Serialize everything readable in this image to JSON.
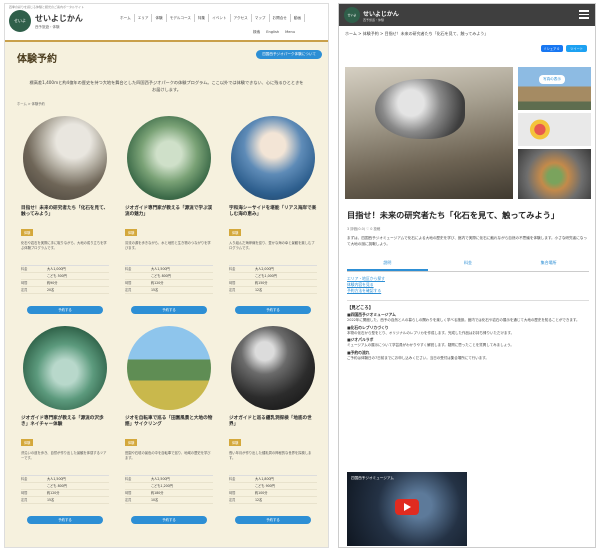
{
  "left": {
    "header_tiny": "四季の彩りを感じる体験と観光のご案内ポータルサイト",
    "logo_text": "せいよ",
    "brand": "せいよじかん",
    "brand_sub": "西予旅遊・体験",
    "nav": [
      "ホーム",
      "エリア",
      "体験",
      "モデルコース",
      "特集",
      "イベント",
      "アクセス",
      "マップ",
      "お問合せ",
      "動画"
    ],
    "nav2": [
      "検索",
      "English",
      "Menu"
    ],
    "page_title": "体験予約",
    "pill": "四国西予ジオパーク体験について",
    "intro": "標高差1,400mと約4億年の歴史を持つ大地を舞台とした四国西予ジオパークの体験プログラム。ここ以外では体験できない、心に残るひとときをお届けします。",
    "breadcrumb": "ホーム > 体験予約",
    "cards": [
      {
        "title": "目指せ！未来の研究者たち「化石を見て、触ってみよう」",
        "tag": "体験",
        "desc": "化石や岩石を実際に手に取りながら、大地の成り立ちを学ぶ体験プログラムです。",
        "rows": [
          [
            "料金",
            "大人1,000円"
          ],
          [
            "",
            "こども 500円"
          ],
          [
            "時間",
            "約90分"
          ],
          [
            "定員",
            "20名"
          ]
        ],
        "button": "予約する"
      },
      {
        "title": "ジオガイド専門家が教える「源流で学ぶ渓流の魅力」",
        "tag": "体験",
        "desc": "清流の源を歩きながら、水と地形と生き物のつながりを学びます。",
        "rows": [
          [
            "料金",
            "大人1,500円"
          ],
          [
            "",
            "こども 800円"
          ],
          [
            "時間",
            "約120分"
          ],
          [
            "定員",
            "15名"
          ]
        ],
        "button": "予約する"
      },
      {
        "title": "宇和海シーサイドを堪能「リアス海岸で楽しむ海の恵み」",
        "tag": "体験",
        "desc": "入り組んだ海岸線を巡り、豊かな海の幸と景観を楽しむプログラムです。",
        "rows": [
          [
            "料金",
            "大人2,000円"
          ],
          [
            "",
            "こども1,000円"
          ],
          [
            "時間",
            "約150分"
          ],
          [
            "定員",
            "12名"
          ]
        ],
        "button": "予約する"
      },
      {
        "title": "ジオガイド専門家が教える「源流の沢歩き」ネイチャー体験",
        "tag": "体験",
        "desc": "沢沿いの道を歩き、自然が作り出した景観を体感するツアーです。",
        "rows": [
          [
            "料金",
            "大人1,500円"
          ],
          [
            "",
            "こども 800円"
          ],
          [
            "時間",
            "約120分"
          ],
          [
            "定員",
            "15名"
          ]
        ],
        "button": "予約する"
      },
      {
        "title": "ジオを自転車で巡る「田園風景と大地の物語」サイクリング",
        "tag": "体験",
        "desc": "田園や石垣の景色の中を自転車で巡り、地域の歴史を学びます。",
        "rows": [
          [
            "料金",
            "大人2,500円"
          ],
          [
            "",
            "こども1,200円"
          ],
          [
            "時間",
            "約180分"
          ],
          [
            "定員",
            "10名"
          ]
        ],
        "button": "予約する"
      },
      {
        "title": "ジオガイドと巡る鍾乳洞探検「地底の世界」",
        "tag": "体験",
        "desc": "長い年月が作り出した鍾乳洞の神秘的な世界を探検します。",
        "rows": [
          [
            "料金",
            "大人1,800円"
          ],
          [
            "",
            "こども 900円"
          ],
          [
            "時間",
            "約100分"
          ],
          [
            "定員",
            "12名"
          ]
        ],
        "button": "予約する"
      }
    ]
  },
  "right": {
    "logo_text": "せいよ",
    "brand": "せいよじかん",
    "brand_sub": "西予旅遊・体験",
    "breadcrumb": "ホーム > 体験予約 > 目指せ！未来の研究者たち「化石を見て、触ってみよう」",
    "share_fb": "f シェア 0",
    "share_tw": "ツイート",
    "gallery_button": "写真の表示",
    "title": "目指せ！未来の研究者たち「化石を見て、触ってみよう」",
    "meta": "3 評価(0.0)  ♡ 0 投稿",
    "body": "まずは、四国西予ジオミュージアムで化石による大地の歴史を学び、館内で実際に化石に触れながら自然の不思議を体験します。小さな研究者になって大地の謎に挑戦しよう。",
    "tabs": [
      "説明",
      "料金",
      "集合場所"
    ],
    "links": [
      "エリア・地区から探す",
      "体験内容を見る",
      "予約方法を確認する"
    ],
    "section_heading": "【見どころ】",
    "section_items": [
      {
        "h": "■四国西予ジオミュージアム",
        "t": "2022年に開館した、西予の自然と人の暮らしの関わりを楽しく学べる施設。館内では化石や岩石の展示を通じて大地の歴史を知ることができます。"
      },
      {
        "h": "■化石のレプリカづくり",
        "t": "本物の化石から型をとり、オリジナルのレプリカを作成します。完成した作品はお持ち帰りいただけます。"
      },
      {
        "h": "■ジオパルラボ",
        "t": "ミュージアムの展示について学芸員がわかりやすく解説します。疑問に思ったことを質問してみましょう。"
      },
      {
        "h": "■予約の流れ",
        "t": "ご予約は体験日の7日前までにお申し込みください。当日の受付は集合場所にて行います。"
      }
    ],
    "video_title": "四国西予ジオミュージアム"
  }
}
